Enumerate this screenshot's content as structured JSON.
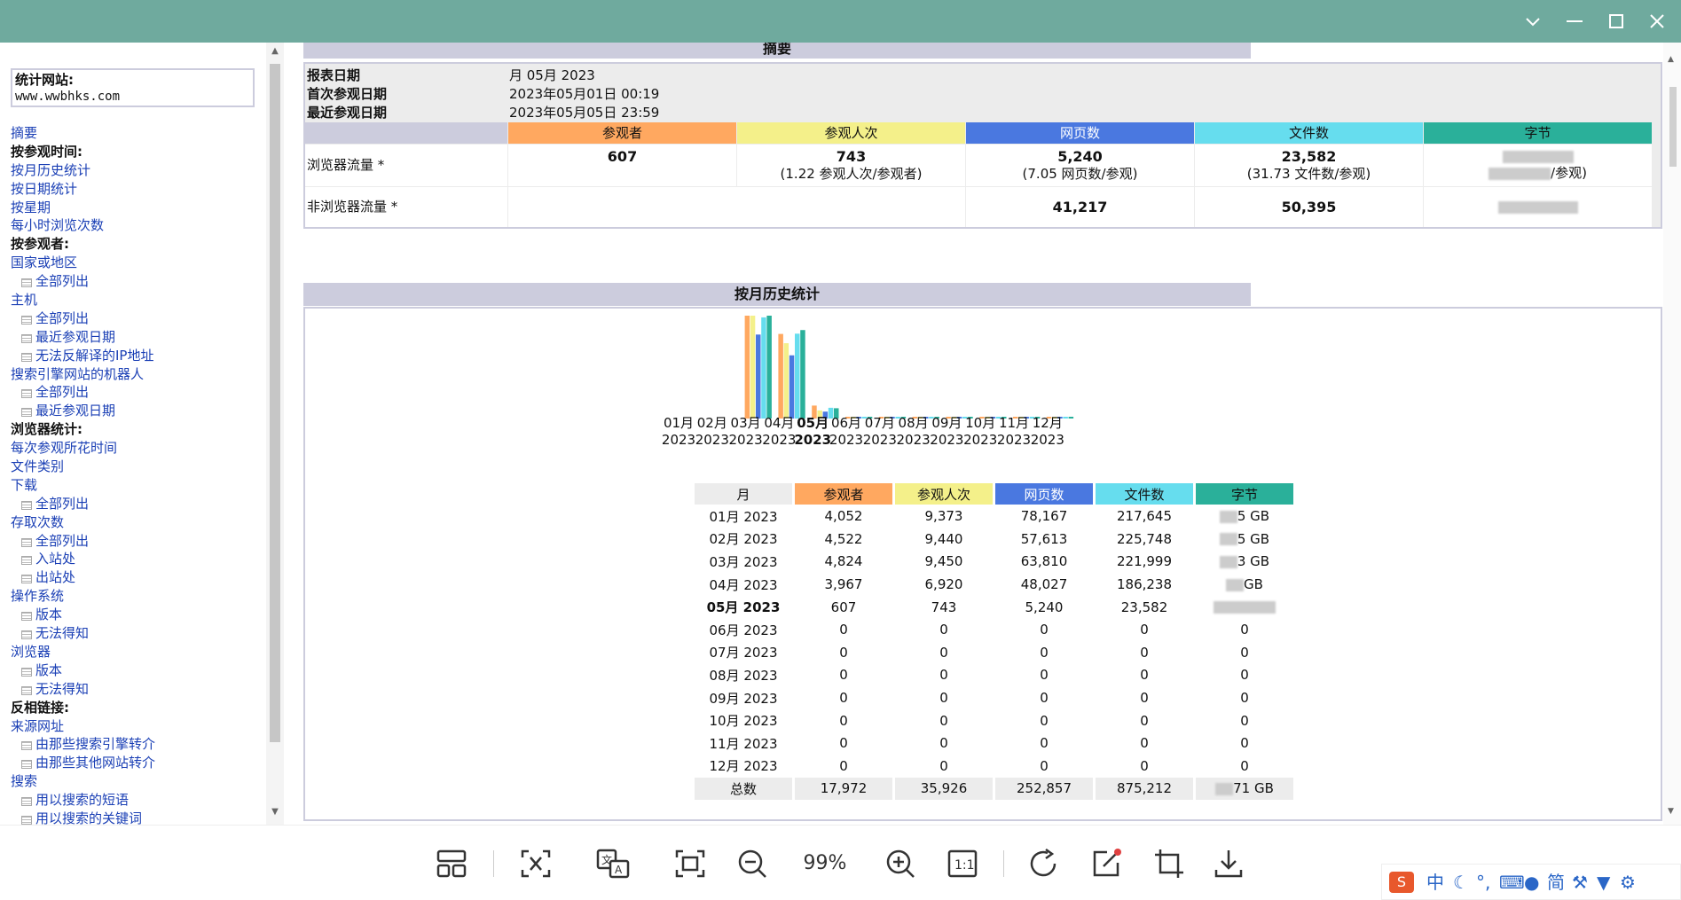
{
  "window": {
    "minimize": "—",
    "maximize": "☐",
    "close": "✕",
    "dropdown": "⌄"
  },
  "sidebar": {
    "site_label": "统计网站:",
    "site_value": "www.wwbhks.com",
    "items": [
      {
        "text": "摘要",
        "kind": "link"
      },
      {
        "text": "按参观时间:",
        "kind": "bold"
      },
      {
        "text": "按月历史统计",
        "kind": "link"
      },
      {
        "text": "按日期统计",
        "kind": "link"
      },
      {
        "text": "按星期",
        "kind": "link"
      },
      {
        "text": "每小时浏览次数",
        "kind": "link"
      },
      {
        "text": "按参观者:",
        "kind": "bold"
      },
      {
        "text": "国家或地区",
        "kind": "link"
      },
      {
        "text": "全部列出",
        "kind": "sub"
      },
      {
        "text": "主机",
        "kind": "link"
      },
      {
        "text": "全部列出",
        "kind": "sub"
      },
      {
        "text": "最近参观日期",
        "kind": "sub"
      },
      {
        "text": "无法反解译的IP地址",
        "kind": "sub"
      },
      {
        "text": "搜索引擎网站的机器人",
        "kind": "link"
      },
      {
        "text": "全部列出",
        "kind": "sub"
      },
      {
        "text": "最近参观日期",
        "kind": "sub"
      },
      {
        "text": "浏览器统计:",
        "kind": "bold"
      },
      {
        "text": "每次参观所花时间",
        "kind": "link"
      },
      {
        "text": "文件类别",
        "kind": "link"
      },
      {
        "text": "下载",
        "kind": "link"
      },
      {
        "text": "全部列出",
        "kind": "sub"
      },
      {
        "text": "存取次数",
        "kind": "link"
      },
      {
        "text": "全部列出",
        "kind": "sub"
      },
      {
        "text": "入站处",
        "kind": "sub"
      },
      {
        "text": "出站处",
        "kind": "sub"
      },
      {
        "text": "操作系统",
        "kind": "link"
      },
      {
        "text": "版本",
        "kind": "sub"
      },
      {
        "text": "无法得知",
        "kind": "sub"
      },
      {
        "text": "浏览器",
        "kind": "link"
      },
      {
        "text": "版本",
        "kind": "sub"
      },
      {
        "text": "无法得知",
        "kind": "sub"
      },
      {
        "text": "反相链接:",
        "kind": "bold"
      },
      {
        "text": "来源网址",
        "kind": "link"
      },
      {
        "text": "由那些搜索引擎转介",
        "kind": "sub"
      },
      {
        "text": "由那些其他网站转介",
        "kind": "sub"
      },
      {
        "text": "搜索",
        "kind": "link"
      },
      {
        "text": "用以搜索的短语",
        "kind": "sub"
      },
      {
        "text": "用以搜索的关键词",
        "kind": "sub"
      }
    ]
  },
  "summary": {
    "title": "摘要",
    "report_date_label": "报表日期",
    "report_date": "月 05月 2023",
    "first_visit_label": "首次参观日期",
    "first_visit": "2023年05月01日 00:19",
    "last_visit_label": "最近参观日期",
    "last_visit": "2023年05月05日 23:59",
    "columns": [
      "参观者",
      "参观人次",
      "网页数",
      "文件数",
      "字节"
    ],
    "col_colors": [
      "#ffa860",
      "#f4f08a",
      "#4a78e0",
      "#66ddee",
      "#2ab09a"
    ],
    "browser_label": "浏览器流量 *",
    "browser": {
      "visitors": "607",
      "visits": "743",
      "visits_sub": "(1.22 参观人次/参观者)",
      "pages": "5,240",
      "pages_sub": "(7.05 网页数/参观)",
      "files": "23,582",
      "files_sub": "(31.73 文件数/参观)",
      "bytes_sub": "/参观)"
    },
    "nonbrowser_label": "非浏览器流量 *",
    "nonbrowser": {
      "pages": "41,217",
      "files": "50,395"
    }
  },
  "monthly": {
    "title": "按月历史统计",
    "month_labels": [
      "01月",
      "02月",
      "03月",
      "04月",
      "05月",
      "06月",
      "07月",
      "08月",
      "09月",
      "10月",
      "11月",
      "12月"
    ],
    "year": "2023",
    "current_index": 4,
    "table_headers": [
      "月",
      "参观者",
      "参观人次",
      "网页数",
      "文件数",
      "字节"
    ],
    "rows": [
      {
        "month": "01月 2023",
        "visitors": "4,052",
        "visits": "9,373",
        "pages": "78,167",
        "files": "217,645",
        "bytes": "5 GB"
      },
      {
        "month": "02月 2023",
        "visitors": "4,522",
        "visits": "9,440",
        "pages": "57,613",
        "files": "225,748",
        "bytes": "5 GB"
      },
      {
        "month": "03月 2023",
        "visitors": "4,824",
        "visits": "9,450",
        "pages": "63,810",
        "files": "221,999",
        "bytes": "3 GB"
      },
      {
        "month": "04月 2023",
        "visitors": "3,967",
        "visits": "6,920",
        "pages": "48,027",
        "files": "186,238",
        "bytes": "GB"
      },
      {
        "month": "05月 2023",
        "visitors": "607",
        "visits": "743",
        "pages": "5,240",
        "files": "23,582",
        "bytes": ""
      },
      {
        "month": "06月 2023",
        "visitors": "0",
        "visits": "0",
        "pages": "0",
        "files": "0",
        "bytes": "0"
      },
      {
        "month": "07月 2023",
        "visitors": "0",
        "visits": "0",
        "pages": "0",
        "files": "0",
        "bytes": "0"
      },
      {
        "month": "08月 2023",
        "visitors": "0",
        "visits": "0",
        "pages": "0",
        "files": "0",
        "bytes": "0"
      },
      {
        "month": "09月 2023",
        "visitors": "0",
        "visits": "0",
        "pages": "0",
        "files": "0",
        "bytes": "0"
      },
      {
        "month": "10月 2023",
        "visitors": "0",
        "visits": "0",
        "pages": "0",
        "files": "0",
        "bytes": "0"
      },
      {
        "month": "11月 2023",
        "visitors": "0",
        "visits": "0",
        "pages": "0",
        "files": "0",
        "bytes": "0"
      },
      {
        "month": "12月 2023",
        "visitors": "0",
        "visits": "0",
        "pages": "0",
        "files": "0",
        "bytes": "0"
      }
    ],
    "total": {
      "month": "总数",
      "visitors": "17,972",
      "visits": "35,926",
      "pages": "252,857",
      "files": "875,212",
      "bytes": "71 GB"
    }
  },
  "chart_data": {
    "type": "bar",
    "categories": [
      "01月 2023",
      "02月 2023",
      "03月 2023",
      "04月 2023",
      "05月 2023",
      "06月 2023",
      "07月 2023",
      "08月 2023",
      "09月 2023",
      "10月 2023",
      "11月 2023",
      "12月 2023"
    ],
    "series": [
      {
        "name": "参观者",
        "values": [
          4052,
          4522,
          4824,
          3967,
          607,
          0,
          0,
          0,
          0,
          0,
          0,
          0
        ],
        "color": "#ffa860"
      },
      {
        "name": "参观人次",
        "values": [
          9373,
          9440,
          9450,
          6920,
          743,
          0,
          0,
          0,
          0,
          0,
          0,
          0
        ],
        "color": "#f4f08a"
      },
      {
        "name": "网页数",
        "values": [
          78167,
          57613,
          63810,
          48027,
          5240,
          0,
          0,
          0,
          0,
          0,
          0,
          0
        ],
        "color": "#4a78e0"
      },
      {
        "name": "文件数",
        "values": [
          217645,
          225748,
          221999,
          186238,
          23582,
          0,
          0,
          0,
          0,
          0,
          0,
          0
        ],
        "color": "#66ddee"
      },
      {
        "name": "字节",
        "values": [
          5.0,
          5.0,
          5.0,
          4.3,
          0.5,
          0,
          0,
          0,
          0,
          0,
          0,
          0
        ],
        "color": "#2ab09a"
      }
    ],
    "title": "按月历史统计"
  },
  "toolbar": {
    "zoom": "99%",
    "buttons": [
      "layout-icon",
      "ocr-select-icon",
      "translate-icon",
      "fit-screen-icon",
      "zoom-out-icon",
      "zoom-in-icon",
      "actual-size-icon",
      "rotate-icon",
      "edit-icon",
      "crop-icon",
      "download-icon"
    ]
  },
  "ime": {
    "lang": "中",
    "mode": "简"
  }
}
